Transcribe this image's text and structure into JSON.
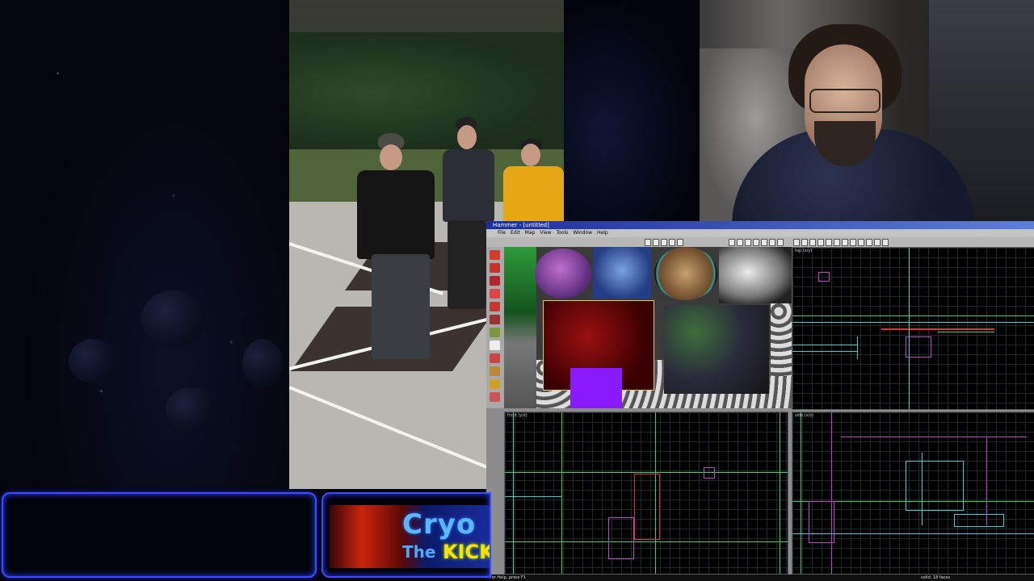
{
  "editor": {
    "title": "Hammer - [untitled]",
    "menu": [
      "File",
      "Edit",
      "Map",
      "View",
      "Tools",
      "Window",
      "Help"
    ],
    "viewports": {
      "camera": "camera",
      "top": "top (x/y)",
      "front": "front (y/z)",
      "side": "side (x/z)"
    },
    "status": "For Help, press F1",
    "status_right": "solid: 18 faces"
  },
  "banner": {
    "logo_line1": "Cryo",
    "logo_line2a": "The",
    "logo_line2b": "KICK"
  },
  "colors": {
    "frame_glow": "#3b4cff",
    "grid_green": "#2fd36a",
    "grid_cyan": "#2fd3d3",
    "grid_magenta": "#c43fd0",
    "grid_red": "#e03030"
  }
}
